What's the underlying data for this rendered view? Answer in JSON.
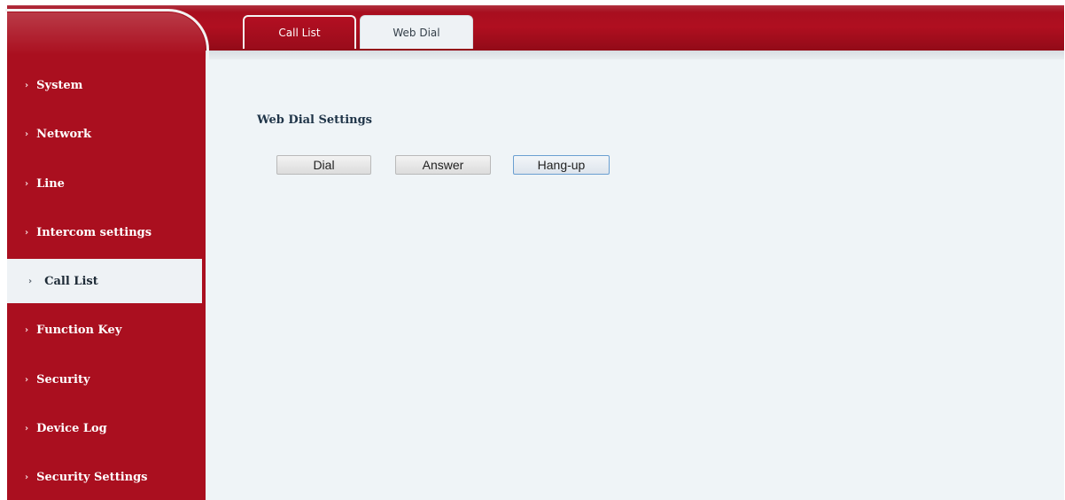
{
  "tabs": {
    "call_list": "Call List",
    "web_dial": "Web Dial"
  },
  "sidebar": {
    "items": [
      {
        "label": "System"
      },
      {
        "label": "Network"
      },
      {
        "label": "Line"
      },
      {
        "label": "Intercom settings"
      },
      {
        "label": "Call List",
        "active": true
      },
      {
        "label": "Function Key"
      },
      {
        "label": "Security"
      },
      {
        "label": "Device Log"
      },
      {
        "label": "Security Settings"
      }
    ],
    "chevron": "›"
  },
  "content": {
    "section_title": "Web Dial Settings",
    "buttons": {
      "dial": "Dial",
      "answer": "Answer",
      "hangup": "Hang-up"
    }
  },
  "colors": {
    "brand_red": "#aa0f1f",
    "content_bg": "#eff4f7",
    "active_item_bg": "#eef2f5",
    "focus_border": "#6a9fd1"
  },
  "icons": {
    "nav_chevron": "chevron-right-icon"
  }
}
